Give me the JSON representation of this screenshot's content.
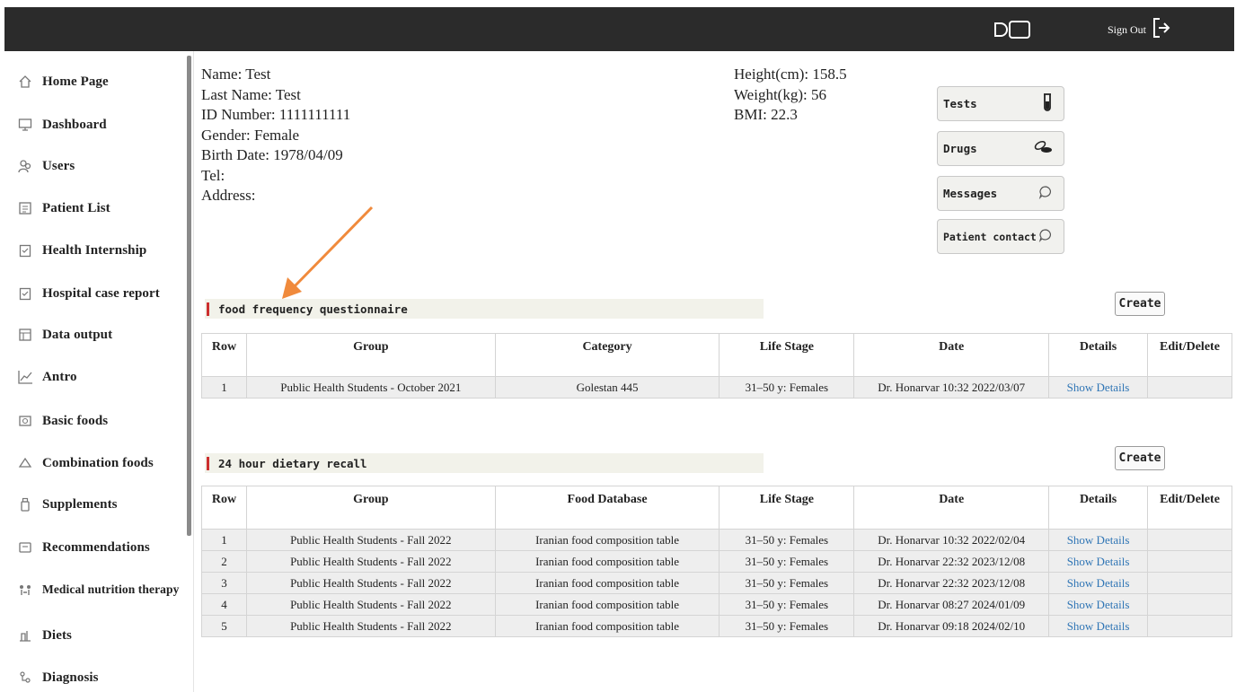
{
  "topbar": {
    "sign_out": "Sign Out"
  },
  "sidebar": {
    "items": [
      {
        "label": "Home Page",
        "icon": "home-icon"
      },
      {
        "label": "Dashboard",
        "icon": "monitor-icon"
      },
      {
        "label": "Users",
        "icon": "users-icon"
      },
      {
        "label": "Patient List",
        "icon": "list-icon"
      },
      {
        "label": "Health Internship",
        "icon": "clipboard-icon"
      },
      {
        "label": "Hospital case report",
        "icon": "clipboard-icon"
      },
      {
        "label": "Data output",
        "icon": "export-icon"
      },
      {
        "label": "Antro",
        "icon": "chart-icon"
      },
      {
        "label": "Basic foods",
        "icon": "food-icon"
      },
      {
        "label": "Combination foods",
        "icon": "bowl-icon"
      },
      {
        "label": "Supplements",
        "icon": "bottle-icon"
      },
      {
        "label": "Recommendations",
        "icon": "note-icon"
      },
      {
        "label": "Medical nutrition therapy",
        "icon": "therapy-icon"
      },
      {
        "label": "Diets",
        "icon": "diet-icon"
      },
      {
        "label": "Diagnosis",
        "icon": "diagnosis-icon"
      }
    ]
  },
  "patient": {
    "name": "Name:  Test",
    "last_name": "Last Name: Test",
    "id_number": "ID Number: 1111111111",
    "gender": "Gender: Female",
    "birth_date": "Birth Date: 1978/04/09",
    "tel": "Tel:",
    "address": "Address:",
    "height": "Height(cm): 158.5",
    "weight": "Weight(kg): 56",
    "bmi": "BMI: 22.3"
  },
  "quick_buttons": {
    "tests": "Tests",
    "drugs": "Drugs",
    "messages": "Messages",
    "patient_contact": "Patient contact"
  },
  "ffq": {
    "title": "food frequency questionnaire",
    "create": "Create",
    "headers": [
      "Row",
      "Group",
      "Category",
      "Life Stage",
      "Date",
      "Details",
      "Edit/Delete"
    ],
    "rows": [
      [
        "1",
        "Public Health Students - October 2021",
        "Golestan 445",
        "31–50 y: Females",
        "Dr. Honarvar 10:32 2022/03/07",
        "Show Details",
        ""
      ]
    ]
  },
  "recall": {
    "title": "24 hour dietary recall",
    "create": "Create",
    "headers": [
      "Row",
      "Group",
      "Food Database",
      "Life Stage",
      "Date",
      "Details",
      "Edit/Delete"
    ],
    "rows": [
      [
        "1",
        "Public Health Students - Fall 2022",
        "Iranian food composition table",
        "31–50 y: Females",
        "Dr. Honarvar 10:32 2022/02/04",
        "Show Details",
        ""
      ],
      [
        "2",
        "Public Health Students - Fall 2022",
        "Iranian food composition table",
        "31–50 y: Females",
        "Dr. Honarvar 22:32 2023/12/08",
        "Show Details",
        ""
      ],
      [
        "3",
        "Public Health Students - Fall 2022",
        "Iranian food composition table",
        "31–50 y: Females",
        "Dr. Honarvar 22:32 2023/12/08",
        "Show Details",
        ""
      ],
      [
        "4",
        "Public Health Students - Fall 2022",
        "Iranian food composition table",
        "31–50 y: Females",
        "Dr. Honarvar 08:27 2024/01/09",
        "Show Details",
        ""
      ],
      [
        "5",
        "Public Health Students - Fall 2022",
        "Iranian food composition table",
        "31–50 y: Females",
        "Dr. Honarvar 09:18 2024/02/10",
        "Show Details",
        ""
      ]
    ]
  },
  "colors": {
    "topbar": "#2b2b2b",
    "section_marker": "#cc2f2f",
    "link": "#2f75b5",
    "arrow": "#f08a3c"
  }
}
